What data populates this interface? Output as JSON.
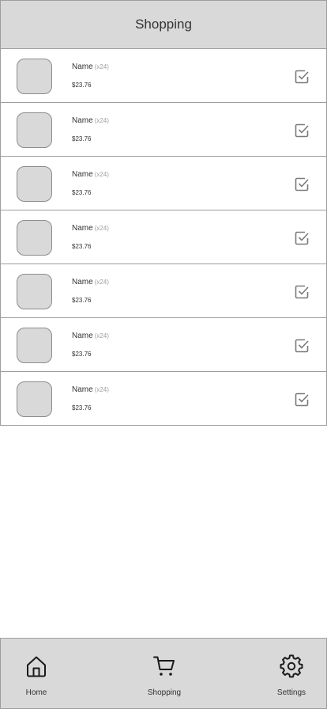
{
  "header": {
    "title": "Shopping"
  },
  "items": [
    {
      "name": "Name",
      "qty": "(x24)",
      "price": "$23.76"
    },
    {
      "name": "Name",
      "qty": "(x24)",
      "price": "$23.76"
    },
    {
      "name": "Name",
      "qty": "(x24)",
      "price": "$23.76"
    },
    {
      "name": "Name",
      "qty": "(x24)",
      "price": "$23.76"
    },
    {
      "name": "Name",
      "qty": "(x24)",
      "price": "$23.76"
    },
    {
      "name": "Name",
      "qty": "(x24)",
      "price": "$23.76"
    },
    {
      "name": "Name",
      "qty": "(x24)",
      "price": "$23.76"
    }
  ],
  "tabbar": {
    "tabs": [
      {
        "label": "Home",
        "icon": "home-icon"
      },
      {
        "label": "Shopping",
        "icon": "cart-icon"
      },
      {
        "label": "Settings",
        "icon": "gear-icon"
      }
    ]
  },
  "colors": {
    "panel": "#d9d9d9",
    "border": "#9e9e9e",
    "text": "#333333",
    "muted": "#9e9e9e"
  }
}
